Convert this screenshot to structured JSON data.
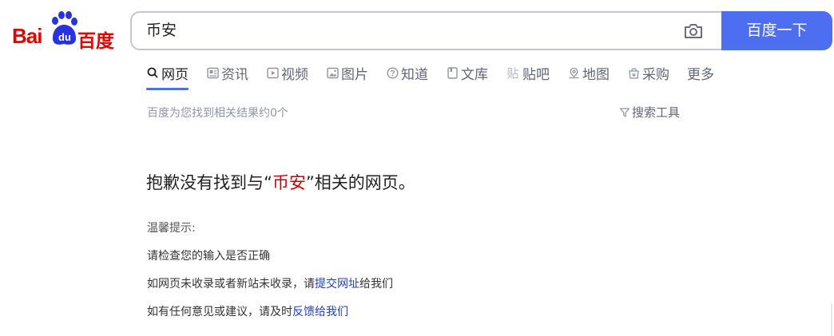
{
  "logo": {
    "left_text": "Bai",
    "paw_text": "du",
    "right_text": "百度"
  },
  "search": {
    "query": "币安",
    "button_label": "百度一下"
  },
  "tabs": [
    {
      "label": "网页",
      "icon": "search-icon"
    },
    {
      "label": "资讯",
      "icon": "news-icon"
    },
    {
      "label": "视频",
      "icon": "video-icon"
    },
    {
      "label": "图片",
      "icon": "image-icon"
    },
    {
      "label": "知道",
      "icon": "question-icon"
    },
    {
      "label": "文库",
      "icon": "doc-icon"
    },
    {
      "label": "贴吧",
      "icon": "tieba-icon"
    },
    {
      "label": "地图",
      "icon": "map-icon"
    },
    {
      "label": "采购",
      "icon": "purchase-icon"
    },
    {
      "label": "更多",
      "icon": ""
    }
  ],
  "stats": {
    "text": "百度为您找到相关结果约0个",
    "tools_label": "搜索工具"
  },
  "noresult": {
    "prefix": "抱歉没有找到与“",
    "keyword": "币安",
    "suffix": "”相关的网页。"
  },
  "tips": {
    "title": "温馨提示:",
    "line1": "请检查您的输入是否正确",
    "line2_prefix": "如网页未收录或者新站未收录，请",
    "line2_link": "提交网址",
    "line2_suffix": "给我们",
    "line3_prefix": "如有任何意见或建议，请及时",
    "line3_link": "反馈给我们"
  },
  "colors": {
    "brand_blue": "#4e6ef2",
    "logo_red": "#e10602",
    "keyword_red": "#cc0000",
    "link_blue": "#2440b3"
  }
}
